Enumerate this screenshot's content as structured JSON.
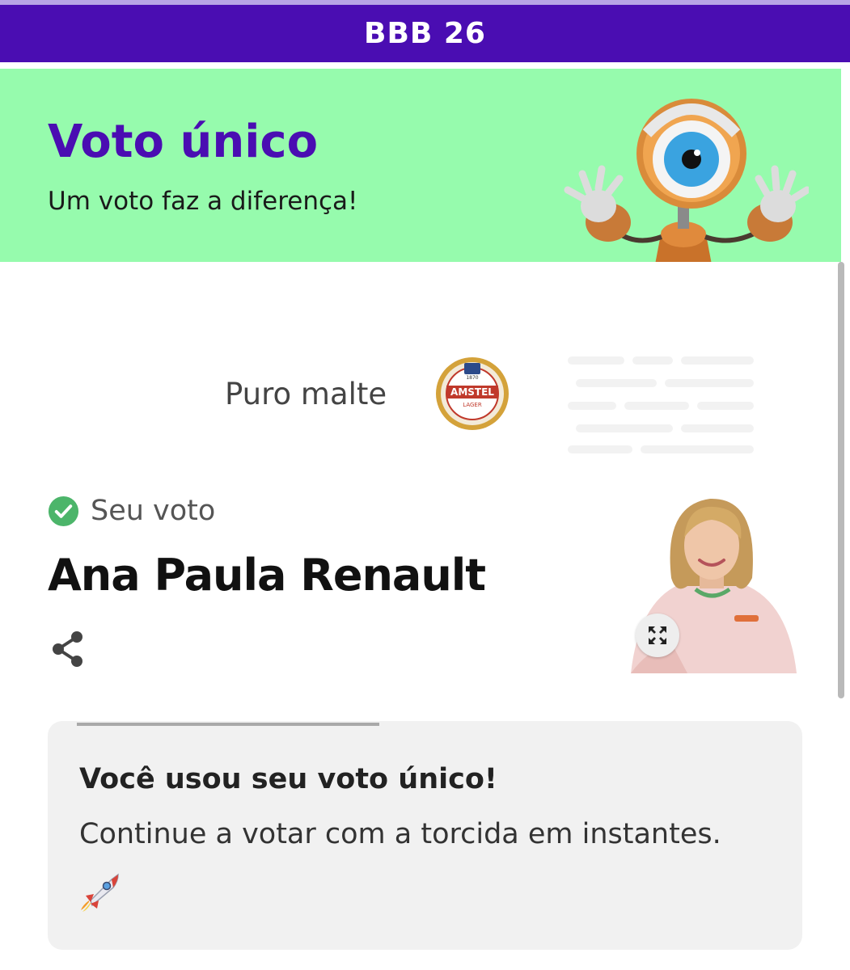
{
  "header": {
    "title": "BBB 26"
  },
  "hero": {
    "title": "Voto único",
    "subtitle": "Um voto faz a diferença!"
  },
  "sponsor": {
    "label": "Puro malte",
    "logo_text": "AMSTEL",
    "logo_subtext": "LAGER",
    "logo_year": "1870"
  },
  "vote": {
    "status_label": "Seu voto",
    "candidate_name": "Ana Paula Renault"
  },
  "notice": {
    "title": "Você usou seu voto único!",
    "message": "Continue a votar com a torcida em instantes."
  },
  "colors": {
    "brand_purple": "#4a0db2",
    "hero_green": "#96fbad",
    "success_green": "#4cb56a",
    "card_bg": "#f1f1f1"
  },
  "icons": [
    "check-circle-icon",
    "share-icon",
    "expand-icon",
    "rocket-icon"
  ]
}
